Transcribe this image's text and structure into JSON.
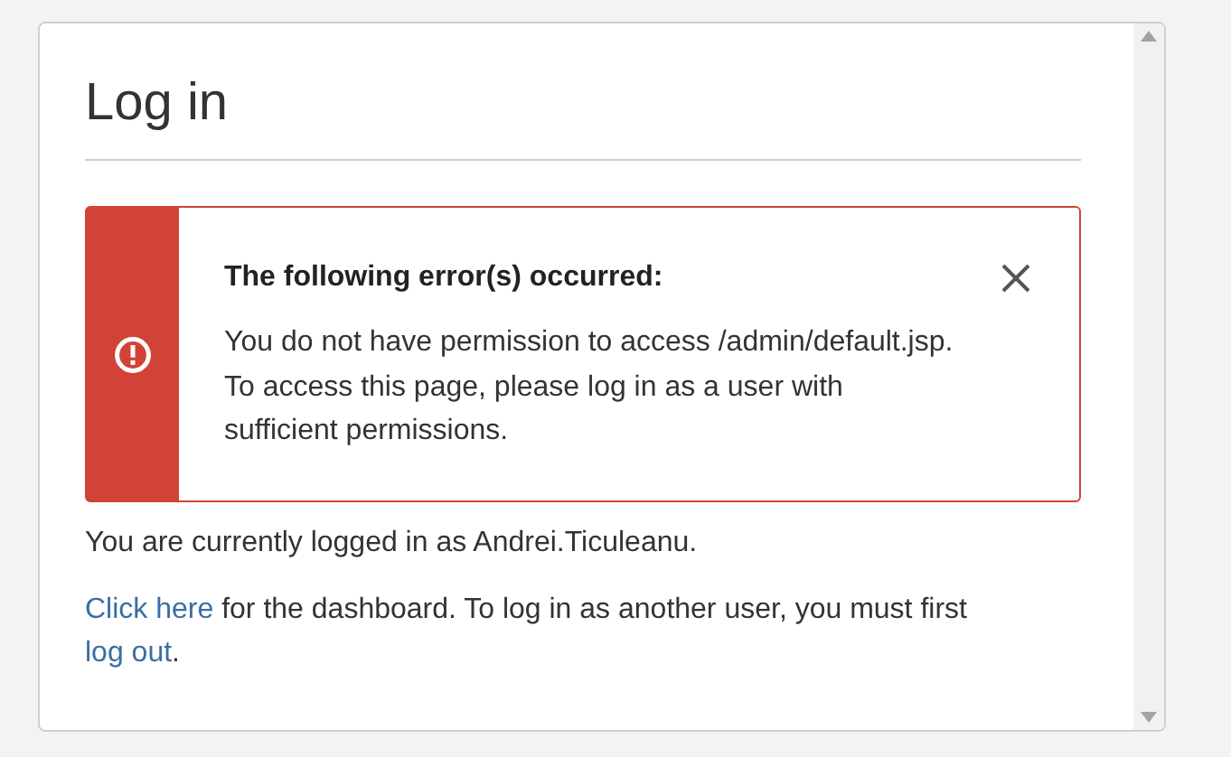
{
  "title": "Log in",
  "alert": {
    "heading": "The following error(s) occurred:",
    "message": "You do not have permission to access /admin/default.jsp. To access this page, please log in as a user with sufficient permissions.",
    "dismissible": true
  },
  "status": "You are currently logged in as Andrei.Ticuleanu.",
  "dashboard_note": [
    {
      "kind": "link",
      "text": "Click here"
    },
    {
      "kind": "text",
      "text": " for the dashboard. To log in as another user, you must first "
    },
    {
      "kind": "link",
      "text": "log out"
    },
    {
      "kind": "text",
      "text": "."
    }
  ]
}
